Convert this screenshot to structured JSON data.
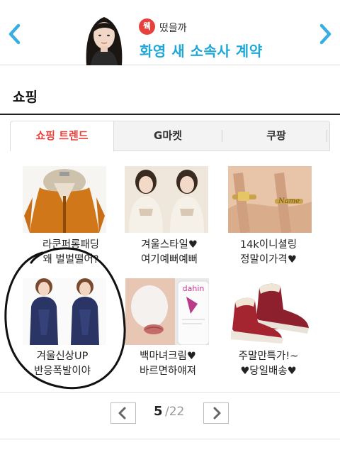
{
  "banner": {
    "prev_icon": "chevron-left-icon",
    "next_icon": "chevron-right-icon",
    "badge": "웩",
    "teaser": "떴을까",
    "headline": "화영 새 소속사 계약",
    "accent_color": "#1ea8d8",
    "badge_color": "#e8413b"
  },
  "section": {
    "title": "쇼핑"
  },
  "tabs": [
    {
      "label": "쇼핑 트렌드",
      "active": true
    },
    {
      "label": "G마켓",
      "active": false
    },
    {
      "label": "쿠팡",
      "active": false
    }
  ],
  "products": [
    {
      "line1": "라쿤퍼롱패딩",
      "line2": "왜 벌벌떨어?"
    },
    {
      "line1": "겨울스타일♥",
      "line2": "여기예뻐예뻐"
    },
    {
      "line1": "14k이니셜링",
      "line2": "정말이가격♥"
    },
    {
      "line1": "겨울신상UP",
      "line2": "반응폭발이야"
    },
    {
      "line1": "백마녀크림♥",
      "line2": "바르면하얘져"
    },
    {
      "line1": "주말만특가!~",
      "line2": "♥당일배송♥"
    }
  ],
  "product_image_label": "dahin",
  "pagination": {
    "current": "5",
    "total": "/22"
  }
}
